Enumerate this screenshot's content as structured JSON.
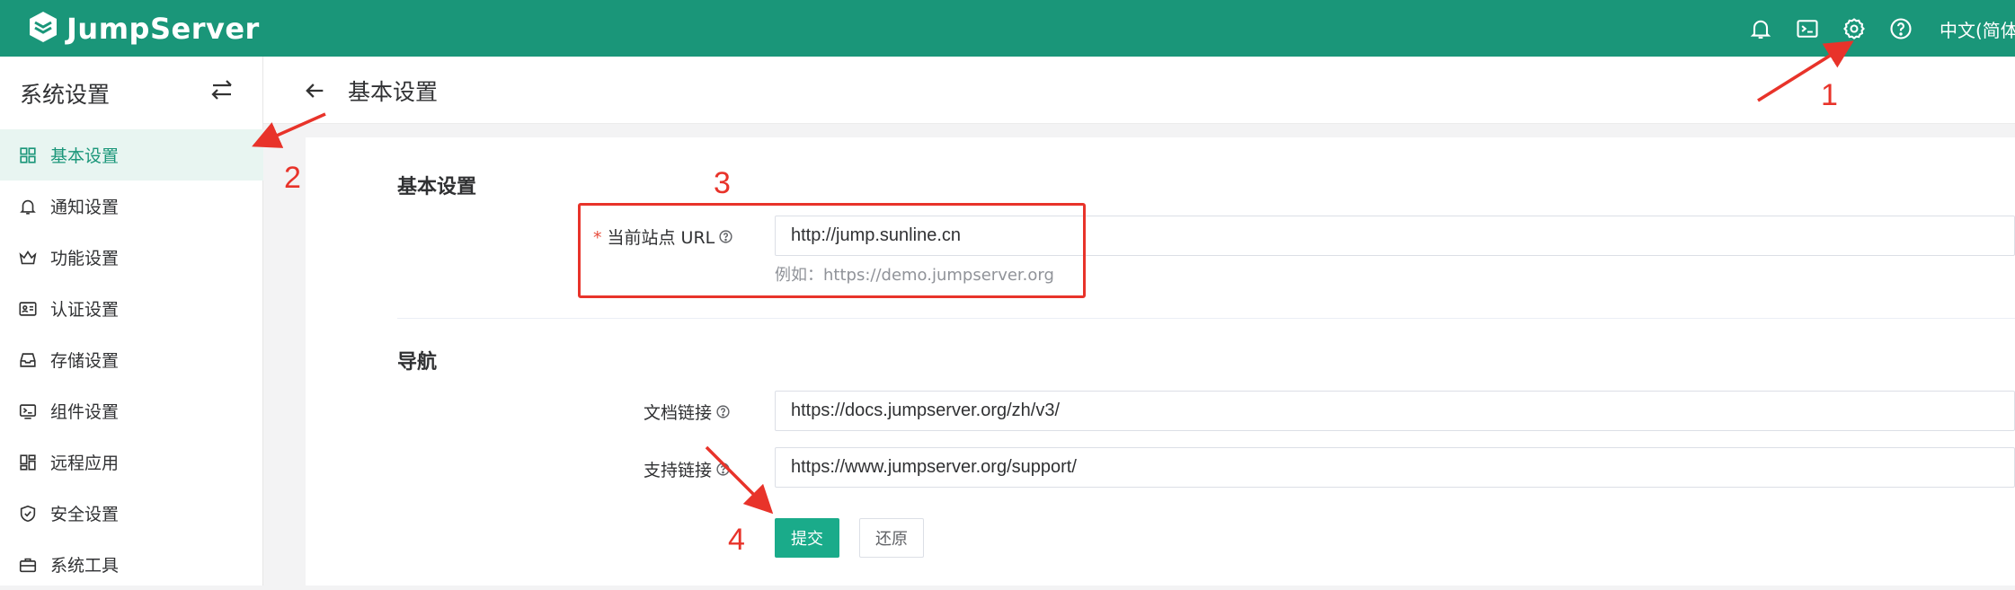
{
  "app": {
    "name": "JumpServer"
  },
  "topbar": {
    "icons": [
      "bell-icon",
      "terminal-icon",
      "gear-icon",
      "question-icon"
    ],
    "language": "中文(简体"
  },
  "sidebar": {
    "title": "系统设置",
    "items": [
      {
        "label": "基本设置",
        "icon": "grid-icon",
        "active": true
      },
      {
        "label": "通知设置",
        "icon": "bell-icon",
        "active": false
      },
      {
        "label": "功能设置",
        "icon": "crown-icon",
        "active": false
      },
      {
        "label": "认证设置",
        "icon": "id-card-icon",
        "active": false
      },
      {
        "label": "存储设置",
        "icon": "inbox-icon",
        "active": false
      },
      {
        "label": "组件设置",
        "icon": "terminal-icon",
        "active": false
      },
      {
        "label": "远程应用",
        "icon": "apps-icon",
        "active": false
      },
      {
        "label": "安全设置",
        "icon": "shield-icon",
        "active": false
      },
      {
        "label": "系统工具",
        "icon": "toolbox-icon",
        "active": false
      }
    ]
  },
  "header": {
    "title": "基本设置"
  },
  "form": {
    "basic": {
      "title": "基本设置",
      "site_url_label": "当前站点 URL",
      "site_url_value": "http://jump.sunline.cn",
      "site_url_hint": "例如：https://demo.jumpserver.org"
    },
    "nav": {
      "title": "导航",
      "docs_label": "文档链接",
      "docs_value": "https://docs.jumpserver.org/zh/v3/",
      "support_label": "支持链接",
      "support_value": "https://www.jumpserver.org/support/"
    },
    "submit_label": "提交",
    "reset_label": "还原"
  },
  "annotations": [
    "1",
    "2",
    "3",
    "4"
  ],
  "colors": {
    "brand": "#1a9679",
    "primary_button": "#1aab8a",
    "annotation": "#e8332a"
  }
}
